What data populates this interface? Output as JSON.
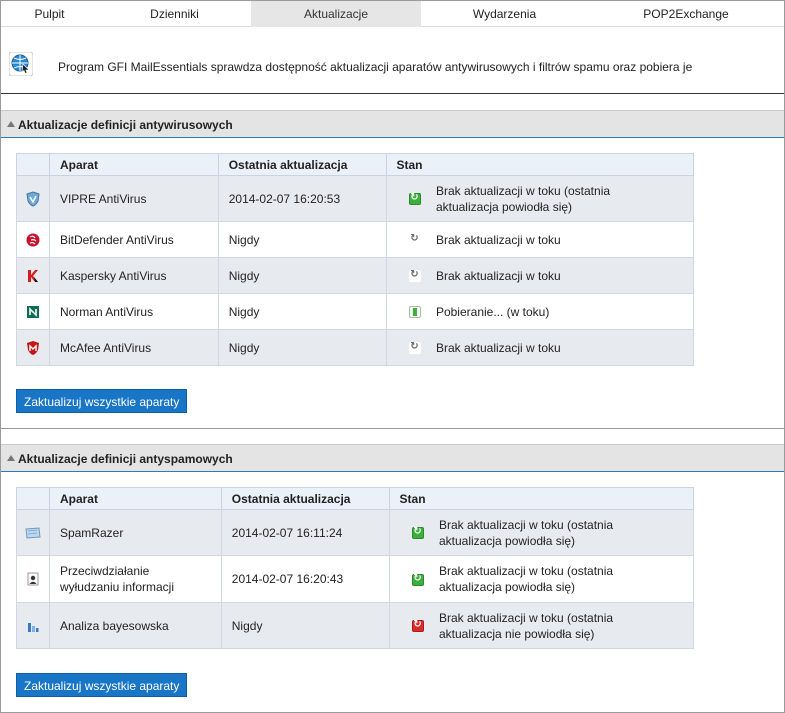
{
  "tabs": [
    {
      "label": "Pulpit"
    },
    {
      "label": "Dzienniki"
    },
    {
      "label": "Aktualizacje",
      "active": true
    },
    {
      "label": "Wydarzenia"
    },
    {
      "label": "POP2Exchange"
    }
  ],
  "intro": {
    "icon": "globe-update-icon",
    "text": "Program GFI MailEssentials sprawdza dostępność aktualizacji aparatów antywirusowych i filtrów spamu oraz pobiera je"
  },
  "antivirus": {
    "title": "Aktualizacje definicji antywirusowych",
    "columns": {
      "engine": "Aparat",
      "last_update": "Ostatnia aktualizacja",
      "status": "Stan"
    },
    "rows": [
      {
        "icon": "vipre-shield-icon",
        "engine": "VIPRE AntiVirus",
        "last_update": "2014-02-07 16:20:53",
        "status_icon": "green",
        "status_line1": "Brak aktualizacji w toku (ostatnia",
        "status_line2": "aktualizacja powiodła się)"
      },
      {
        "icon": "bitdefender-icon",
        "engine": "BitDefender AntiVirus",
        "last_update": "Nigdy",
        "status_icon": "grey",
        "status_line1": "Brak aktualizacji w toku",
        "status_line2": ""
      },
      {
        "icon": "kaspersky-icon",
        "engine": "Kaspersky AntiVirus",
        "last_update": "Nigdy",
        "status_icon": "grey",
        "status_line1": "Brak aktualizacji w toku",
        "status_line2": ""
      },
      {
        "icon": "norman-icon",
        "engine": "Norman AntiVirus",
        "last_update": "Nigdy",
        "status_icon": "download",
        "status_line1": "Pobieranie... (w toku)",
        "status_line2": ""
      },
      {
        "icon": "mcafee-icon",
        "engine": "McAfee AntiVirus",
        "last_update": "Nigdy",
        "status_icon": "grey",
        "status_line1": "Brak aktualizacji w toku",
        "status_line2": ""
      }
    ],
    "button": "Zaktualizuj wszystkie aparaty"
  },
  "antispam": {
    "title": "Aktualizacje definicji antyspamowych",
    "columns": {
      "engine": "Aparat",
      "last_update": "Ostatnia aktualizacja",
      "status": "Stan"
    },
    "rows": [
      {
        "icon": "spamrazer-icon",
        "engine": "SpamRazer",
        "engine_line2": "",
        "last_update": "2014-02-07 16:11:24",
        "status_icon": "green",
        "status_line1": "Brak aktualizacji w toku (ostatnia",
        "status_line2": "aktualizacja powiodła się)"
      },
      {
        "icon": "anti-phishing-icon",
        "engine": "Przeciwdziałanie",
        "engine_line2": "wyłudzaniu informacji",
        "last_update": "2014-02-07 16:20:43",
        "status_icon": "green",
        "status_line1": "Brak aktualizacji w toku (ostatnia",
        "status_line2": "aktualizacja powiodła się)"
      },
      {
        "icon": "bayesian-icon",
        "engine": "Analiza bayesowska",
        "engine_line2": "",
        "last_update": "Nigdy",
        "status_icon": "red",
        "status_line1": "Brak aktualizacji w toku (ostatnia",
        "status_line2": "aktualizacja nie powiodła się)"
      }
    ],
    "button": "Zaktualizuj wszystkie aparaty"
  },
  "colors": {
    "accent": "#1976c6",
    "header_bg": "#e4e4e4",
    "row_alt": "#e7ebf0",
    "ok": "#3eae3e",
    "fail": "#d92b2b"
  }
}
